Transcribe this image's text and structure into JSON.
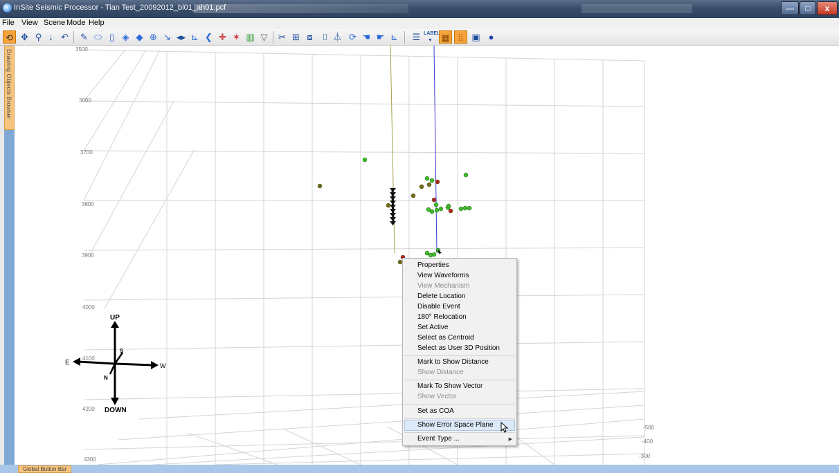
{
  "window": {
    "title": "InSite Seismic Processor - Tian Test_20092012_bl01_ah01.pcf",
    "minimize": "—",
    "maximize": "□",
    "close": "x"
  },
  "menu": [
    "File",
    "View",
    "Scene",
    "Mode",
    "Help"
  ],
  "toolbar": {
    "icons": [
      "rotate-icon",
      "pan-icon",
      "zoom-icon",
      "arrow-down-icon",
      "undo-icon",
      "pencil-icon",
      "ellipse-icon",
      "cylinder-icon",
      "layers-icon",
      "diamond-icon",
      "move-crosshair-icon",
      "stretch-icon",
      "double-arrow-icon",
      "axis-icon",
      "curve-icon",
      "cross-icon",
      "star-icon",
      "histogram-icon",
      "filter-icon",
      "tools-icon",
      "frame-icon",
      "camera-icon",
      "well-icon",
      "plane-icon",
      "refresh-icon",
      "hand-icon",
      "hand2-icon",
      "chart-icon",
      "list-icon",
      "label-icon",
      "grid-highlight-icon",
      "dots-highlight-icon",
      "window-icon",
      "sphere-icon"
    ],
    "label_text": "LABEL"
  },
  "side_tab": "Drawing Objects Browser",
  "bottom_tab": "Global Button Bar",
  "axes": {
    "depth_ticks": [
      "3500",
      "3600",
      "3700",
      "3800",
      "3900",
      "4000",
      "4100",
      "4200",
      "4300"
    ],
    "right_ticks": [
      "-500",
      "-400",
      "-300"
    ]
  },
  "compass": {
    "up": "UP",
    "down": "DOWN",
    "east": "E",
    "west": "W",
    "north": "N",
    "south": "S"
  },
  "context_menu": {
    "items": [
      {
        "label": "Properties",
        "enabled": true
      },
      {
        "label": "View Waveforms",
        "enabled": true
      },
      {
        "label": "View Mechanism",
        "enabled": false
      },
      {
        "label": "Delete Location",
        "enabled": true
      },
      {
        "label": "Disable Event",
        "enabled": true
      },
      {
        "label": "180° Relocation",
        "enabled": true
      },
      {
        "label": "Set Active",
        "enabled": true
      },
      {
        "label": "Select as Centroid",
        "enabled": true
      },
      {
        "label": "Select as User 3D Position",
        "enabled": true
      },
      {
        "label": "Mark to Show Distance",
        "enabled": true
      },
      {
        "label": "Show Distance",
        "enabled": false
      },
      {
        "label": "Mark To Show Vector",
        "enabled": true
      },
      {
        "label": "Show Vector",
        "enabled": false
      },
      {
        "label": "Set as COA",
        "enabled": true
      },
      {
        "label": "Show Error Space Plane",
        "enabled": true,
        "highlighted": true
      },
      {
        "label": "Event Type ...",
        "enabled": true,
        "submenu": true
      }
    ]
  },
  "colors": {
    "event_green": "#3fbf2a",
    "event_red": "#b8231a",
    "event_olive": "#7a6a1a",
    "highlight_orange": "#f6a33c"
  }
}
